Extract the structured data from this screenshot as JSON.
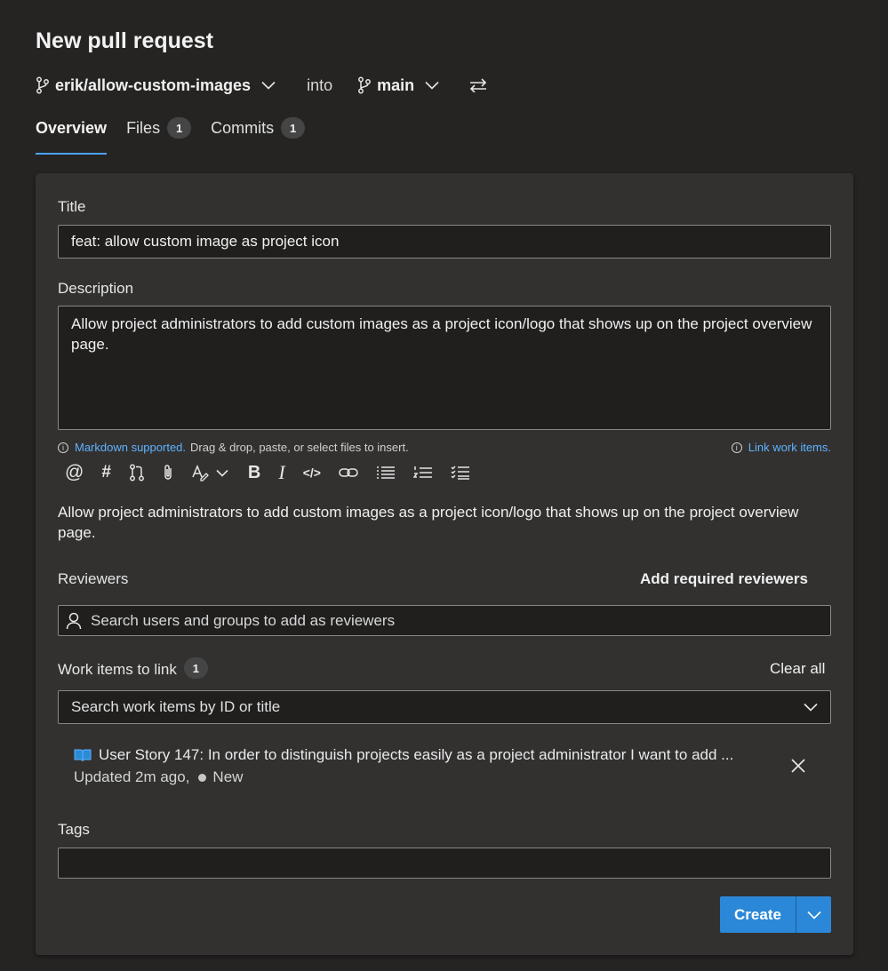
{
  "page": {
    "title": "New pull request"
  },
  "branches": {
    "source": "erik/allow-custom-images",
    "into_label": "into",
    "target": "main"
  },
  "tabs": [
    {
      "label": "Overview"
    },
    {
      "label": "Files",
      "count": "1"
    },
    {
      "label": "Commits",
      "count": "1"
    }
  ],
  "form": {
    "title_label": "Title",
    "title_value": "feat: allow custom image as project icon",
    "description_label": "Description",
    "description_value": "Allow project administrators to add custom images as a project icon/logo that shows up on the project overview page.",
    "markdown_link": "Markdown supported.",
    "markdown_hint": "Drag & drop, paste, or select files to insert.",
    "link_work_items": "Link work items.",
    "preview_text": "Allow project administrators to add custom images as a project icon/logo that shows up on the project overview page.",
    "reviewers_label": "Reviewers",
    "add_required_reviewers": "Add required reviewers",
    "reviewers_placeholder": "Search users and groups to add as reviewers",
    "work_items_label": "Work items to link",
    "work_items_count": "1",
    "clear_all": "Clear all",
    "work_items_placeholder": "Search work items by ID or title",
    "work_item": {
      "title": "User Story 147: In order to distinguish projects easily as a project administrator I want to add ...",
      "updated": "Updated 2m ago,",
      "state": "New"
    },
    "tags_label": "Tags",
    "create_label": "Create"
  },
  "toolbar_icons": [
    "mention-icon",
    "hashtag-icon",
    "pull-request-icon",
    "attach-icon",
    "format-icon",
    "bold-icon",
    "italic-icon",
    "code-icon",
    "link-icon",
    "bullet-list-icon",
    "numbered-list-icon",
    "checklist-icon"
  ],
  "colors": {
    "accent": "#2b88d8",
    "tab_underline": "#4aa3ff",
    "link": "#5fb2ff",
    "background": "#252423",
    "card": "#323130"
  }
}
